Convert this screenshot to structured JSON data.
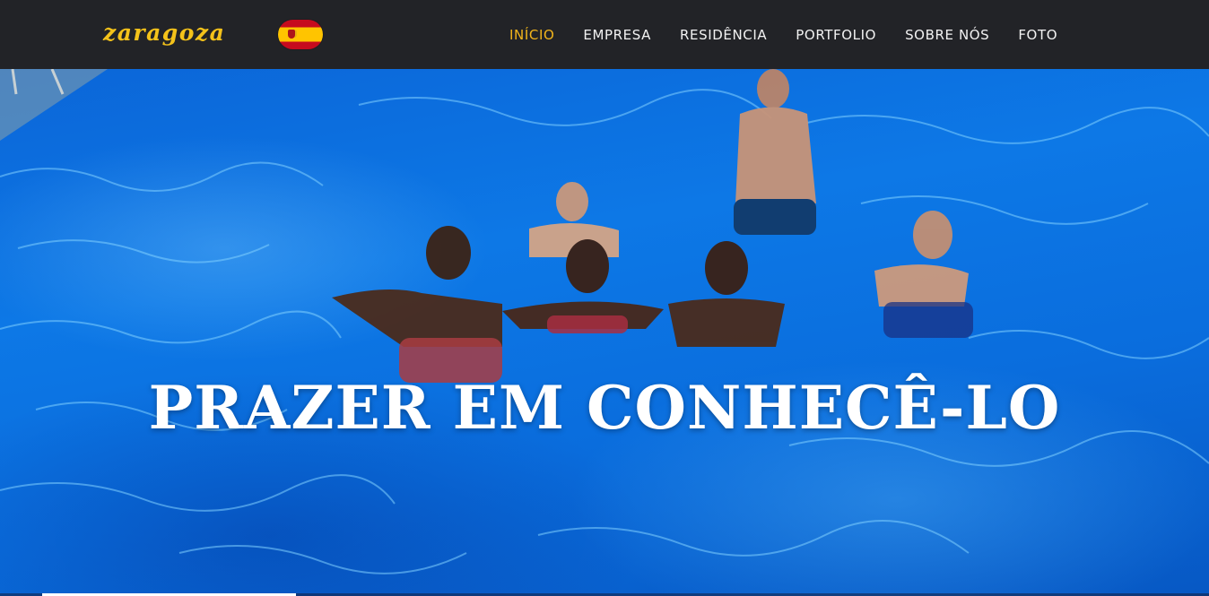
{
  "header": {
    "logo": "zaragoza",
    "language_flag": "spain-flag-icon"
  },
  "nav": {
    "items": [
      {
        "label": "INÍCIO",
        "active": true
      },
      {
        "label": "EMPRESA",
        "active": false
      },
      {
        "label": "RESIDÊNCIA",
        "active": false
      },
      {
        "label": "PORTFOLIO",
        "active": false
      },
      {
        "label": "SOBRE NÓS",
        "active": false
      },
      {
        "label": "FOTO",
        "active": false
      }
    ]
  },
  "hero": {
    "title": "PRAZER EM CONHECÊ-LO",
    "image": "group of young people in a swimming pool",
    "slider_progress": 0.21
  },
  "colors": {
    "navbar_bg": "#222327",
    "accent": "#f3b51b",
    "water": "#0a6ddd"
  }
}
